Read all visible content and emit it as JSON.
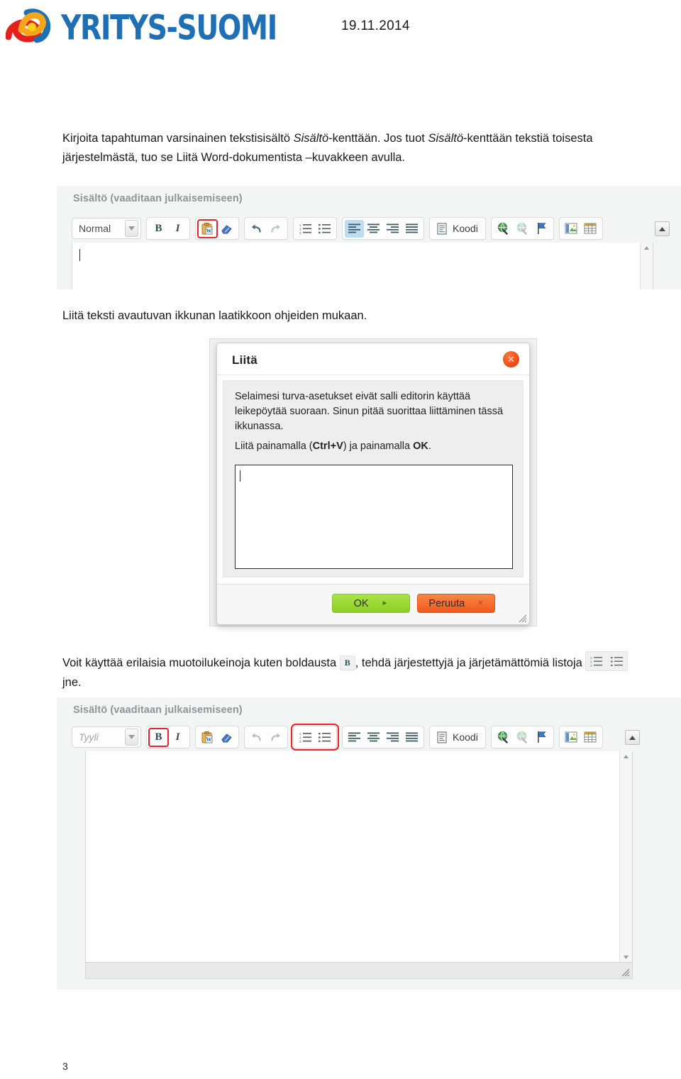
{
  "header": {
    "logo_text": "YRITYS-SUOMI",
    "logo_mark_name": "yritys-suomi-swoosh-logo",
    "date": "19.11.2014"
  },
  "paragraphs": {
    "p1_part1": "Kirjoita tapahtuman varsinainen tekstisisältö ",
    "p1_em1": "Sisältö",
    "p1_part2": "-kenttään. Jos tuot ",
    "p1_em2": "Sisältö",
    "p1_part3": "-kenttään tekstiä toisesta järjestelmästä, tuo se Liitä Word-dokumentista –kuvakkeen avulla.",
    "p2": "Liitä teksti avautuvan ikkunan laatikkoon ohjeiden mukaan.",
    "p3_part1": "Voit käyttää erilaisia muotoilukeinoja kuten boldausta",
    "p3_part2": ", tehdä järjestettyjä ja järjetämättömiä listoja",
    "p3_part3": "jne.",
    "inline_bold_glyph": "B"
  },
  "editor_top": {
    "field_label": "Sisältö (vaaditaan julkaisemiseen)",
    "style_value": "Normal",
    "style_is_placeholder": false,
    "code_button_label": "Koodi",
    "bold_glyph": "B",
    "italic_glyph": "I",
    "highlighted_tool": "paste-from-word"
  },
  "editor_bottom": {
    "field_label": "Sisältö (vaaditaan julkaisemiseen)",
    "style_value": "Tyyli",
    "style_is_placeholder": true,
    "code_button_label": "Koodi",
    "bold_glyph": "B",
    "italic_glyph": "I",
    "highlighted_tools": "bold, numbered-list, bulleted-list"
  },
  "paste_dialog": {
    "title": "Liitä",
    "message_line1": "Selaimesi turva-asetukset eivät salli editorin käyttää",
    "message_line2": "leikepöytää suoraan. Sinun pitää suorittaa liittäminen tässä",
    "message_line3": "ikkunassa.",
    "instruction_pre": "Liitä painamalla (",
    "instruction_shortcut": "Ctrl+V",
    "instruction_mid": ") ja painamalla ",
    "instruction_ok": "OK",
    "instruction_post": ".",
    "textarea_value": "",
    "ok_label": "OK",
    "cancel_label": "Peruuta",
    "ok_chevron": "►",
    "cancel_chevron": "✕",
    "close_glyph": "✕"
  },
  "footer": {
    "page_number": "3"
  },
  "colors": {
    "brand_blue": "#1f6fb5",
    "highlight_red": "#e8232a",
    "ok_green": "#8ece23",
    "cancel_orange": "#f05a1c",
    "label_gray": "#8d9599",
    "active_tool_blue": "#bfdcf5"
  }
}
